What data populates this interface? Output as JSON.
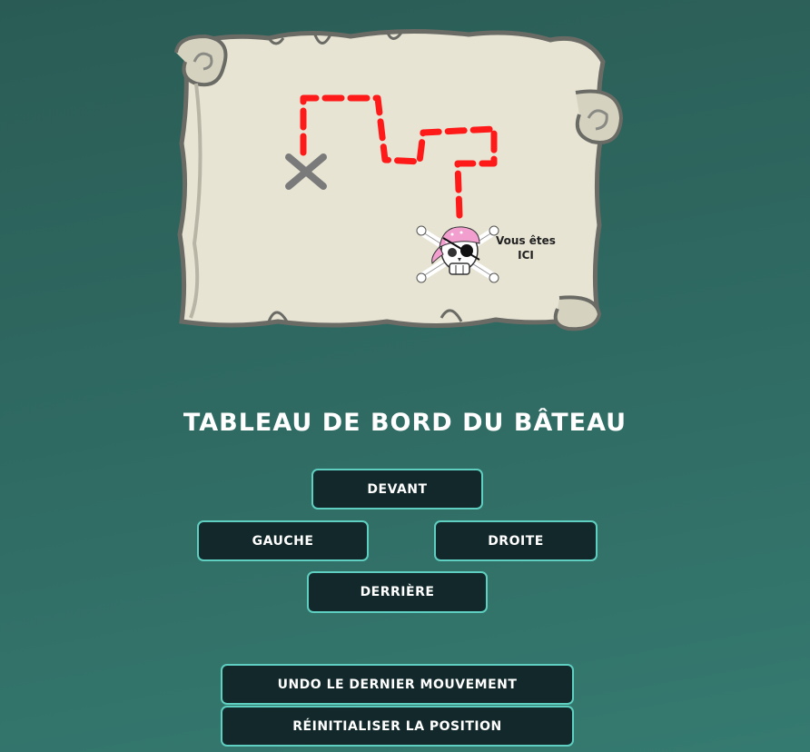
{
  "map": {
    "you_are_here_line1": "Vous êtes",
    "you_are_here_line2": "ICI",
    "route_color": "#ff1a1a",
    "treasure_mark": "x-mark-icon",
    "player_marker": "pirate-skull-icon"
  },
  "dashboard": {
    "title": "TABLEAU DE BORD DU BÂTEAU"
  },
  "controls": {
    "forward": "DEVANT",
    "left": "GAUCHE",
    "right": "DROITE",
    "backward": "DERRIÈRE",
    "undo": "UNDO LE DERNIER MOUVEMENT",
    "reset": "RÉINITIALISER LA POSITION"
  },
  "colors": {
    "background": "#2f6a62",
    "button_bg": "#12282a",
    "button_border": "#5ecfc0",
    "parchment": "#e8e4d4"
  }
}
